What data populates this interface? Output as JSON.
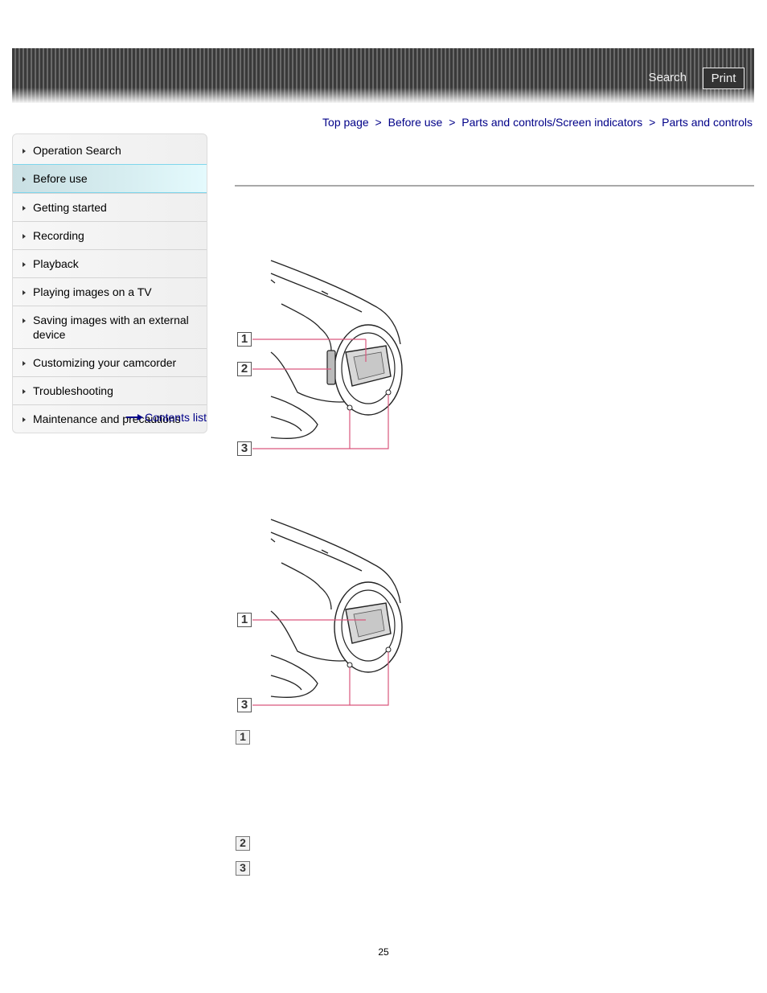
{
  "header": {
    "search_label": "Search",
    "print_label": "Print"
  },
  "breadcrumb": [
    {
      "label": "Top page"
    },
    {
      "label": "Before use"
    },
    {
      "label": "Parts and controls/Screen indicators"
    },
    {
      "label": "Parts and controls"
    }
  ],
  "breadcrumb_separator": ">",
  "sidebar": {
    "items": [
      {
        "label": "Operation Search",
        "active": false
      },
      {
        "label": "Before use",
        "active": true
      },
      {
        "label": "Getting started",
        "active": false
      },
      {
        "label": "Recording",
        "active": false
      },
      {
        "label": "Playback",
        "active": false
      },
      {
        "label": "Playing images on a TV",
        "active": false
      },
      {
        "label": "Saving images with an external device",
        "active": false
      },
      {
        "label": "Customizing your camcorder",
        "active": false
      },
      {
        "label": "Troubleshooting",
        "active": false
      },
      {
        "label": "Maintenance and precautions",
        "active": false
      }
    ],
    "contents_link": "Contents list"
  },
  "figures": [
    {
      "callouts": [
        "1",
        "2",
        "3"
      ]
    },
    {
      "callouts": [
        "1",
        "3"
      ]
    }
  ],
  "legend": [
    "1",
    "2",
    "3"
  ],
  "colors": {
    "link": "#000088",
    "callout_line": "#d9577d",
    "active_nav_border": "#7fd6ec"
  },
  "page_number": "25"
}
